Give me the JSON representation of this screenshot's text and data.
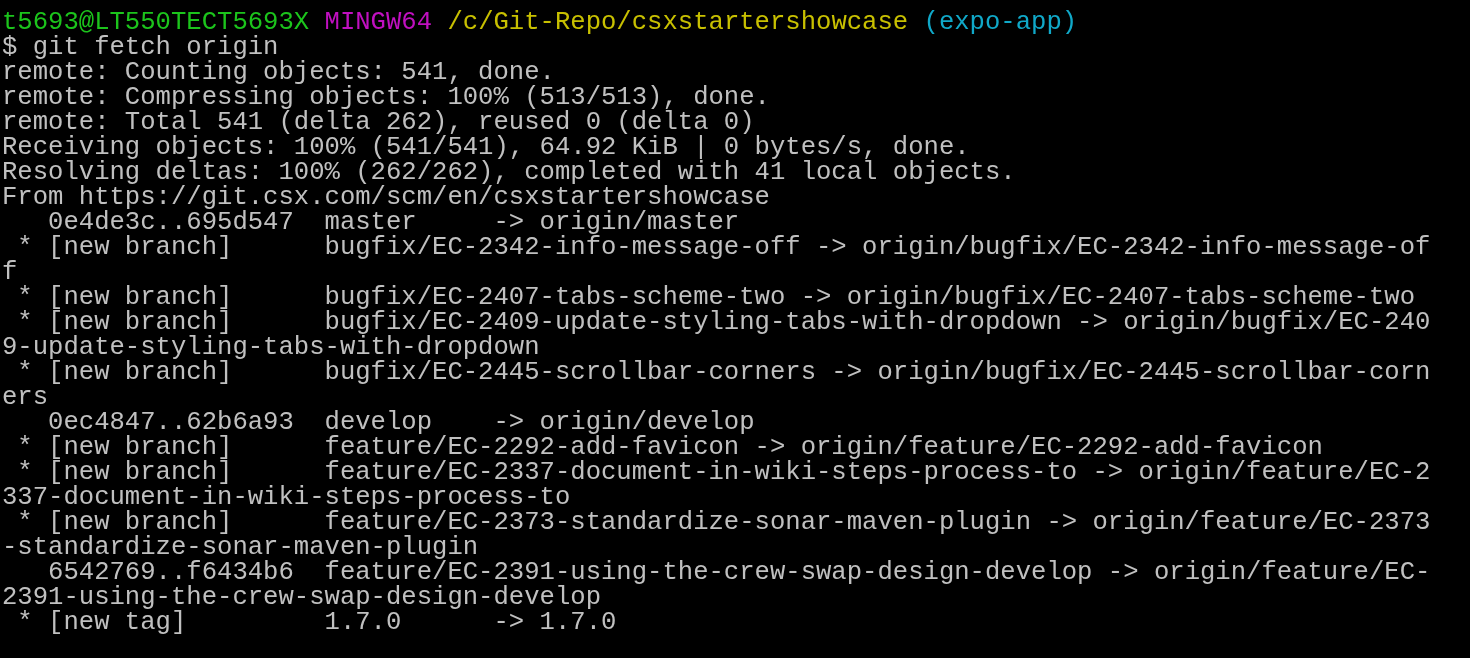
{
  "prompt": {
    "user_host": "t5693@LT550TECT5693X",
    "system": "MINGW64",
    "path": "/c/Git-Repo/csxstartershowcase",
    "branch": "(expo-app)"
  },
  "command": {
    "symbol": "$",
    "text": "git fetch origin"
  },
  "output_lines": [
    "remote: Counting objects: 541, done.",
    "remote: Compressing objects: 100% (513/513), done.",
    "remote: Total 541 (delta 262), reused 0 (delta 0)",
    "Receiving objects: 100% (541/541), 64.92 KiB | 0 bytes/s, done.",
    "Resolving deltas: 100% (262/262), completed with 41 local objects.",
    "From https://git.csx.com/scm/en/csxstartershowcase",
    "   0e4de3c..695d547  master     -> origin/master",
    " * [new branch]      bugfix/EC-2342-info-message-off -> origin/bugfix/EC-2342-info-message-off",
    " * [new branch]      bugfix/EC-2407-tabs-scheme-two -> origin/bugfix/EC-2407-tabs-scheme-two",
    " * [new branch]      bugfix/EC-2409-update-styling-tabs-with-dropdown -> origin/bugfix/EC-2409-update-styling-tabs-with-dropdown",
    " * [new branch]      bugfix/EC-2445-scrollbar-corners -> origin/bugfix/EC-2445-scrollbar-corners",
    "   0ec4847..62b6a93  develop    -> origin/develop",
    " * [new branch]      feature/EC-2292-add-favicon -> origin/feature/EC-2292-add-favicon",
    " * [new branch]      feature/EC-2337-document-in-wiki-steps-process-to -> origin/feature/EC-2337-document-in-wiki-steps-process-to",
    " * [new branch]      feature/EC-2373-standardize-sonar-maven-plugin -> origin/feature/EC-2373-standardize-sonar-maven-plugin",
    "   6542769..f6434b6  feature/EC-2391-using-the-crew-swap-design-develop -> origin/feature/EC-2391-using-the-crew-swap-design-develop",
    " * [new tag]         1.7.0      -> 1.7.0"
  ]
}
